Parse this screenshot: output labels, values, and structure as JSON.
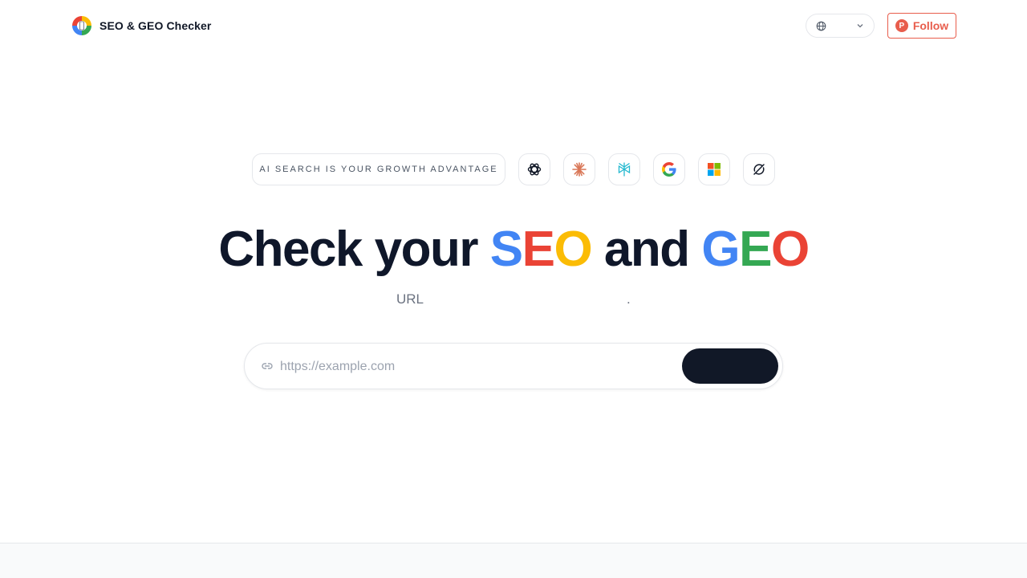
{
  "header": {
    "brand_name": "SEO & GEO Checker",
    "language_icon": "globe-icon",
    "follow_label": "Follow",
    "follow_badge": "P"
  },
  "hero": {
    "tagline": "AI SEARCH IS YOUR GROWTH ADVANTAGE",
    "ai_icons": [
      "openai-icon",
      "claude-icon",
      "perplexity-icon",
      "google-icon",
      "microsoft-icon",
      "grok-icon"
    ],
    "title_part1": "Check your ",
    "title_seo": [
      "S",
      "E",
      "O"
    ],
    "title_part2": " and ",
    "title_geo": [
      "G",
      "E",
      "O"
    ],
    "subtitle_url": "URL",
    "subtitle_dot": "."
  },
  "search": {
    "placeholder": "https://example.com",
    "value": "",
    "submit_label": ""
  },
  "colors": {
    "google_blue": "#4285f4",
    "google_red": "#ea4335",
    "google_yellow": "#fbbc05",
    "google_green": "#34a853",
    "follow_accent": "#e85d4c",
    "dark": "#111827"
  }
}
